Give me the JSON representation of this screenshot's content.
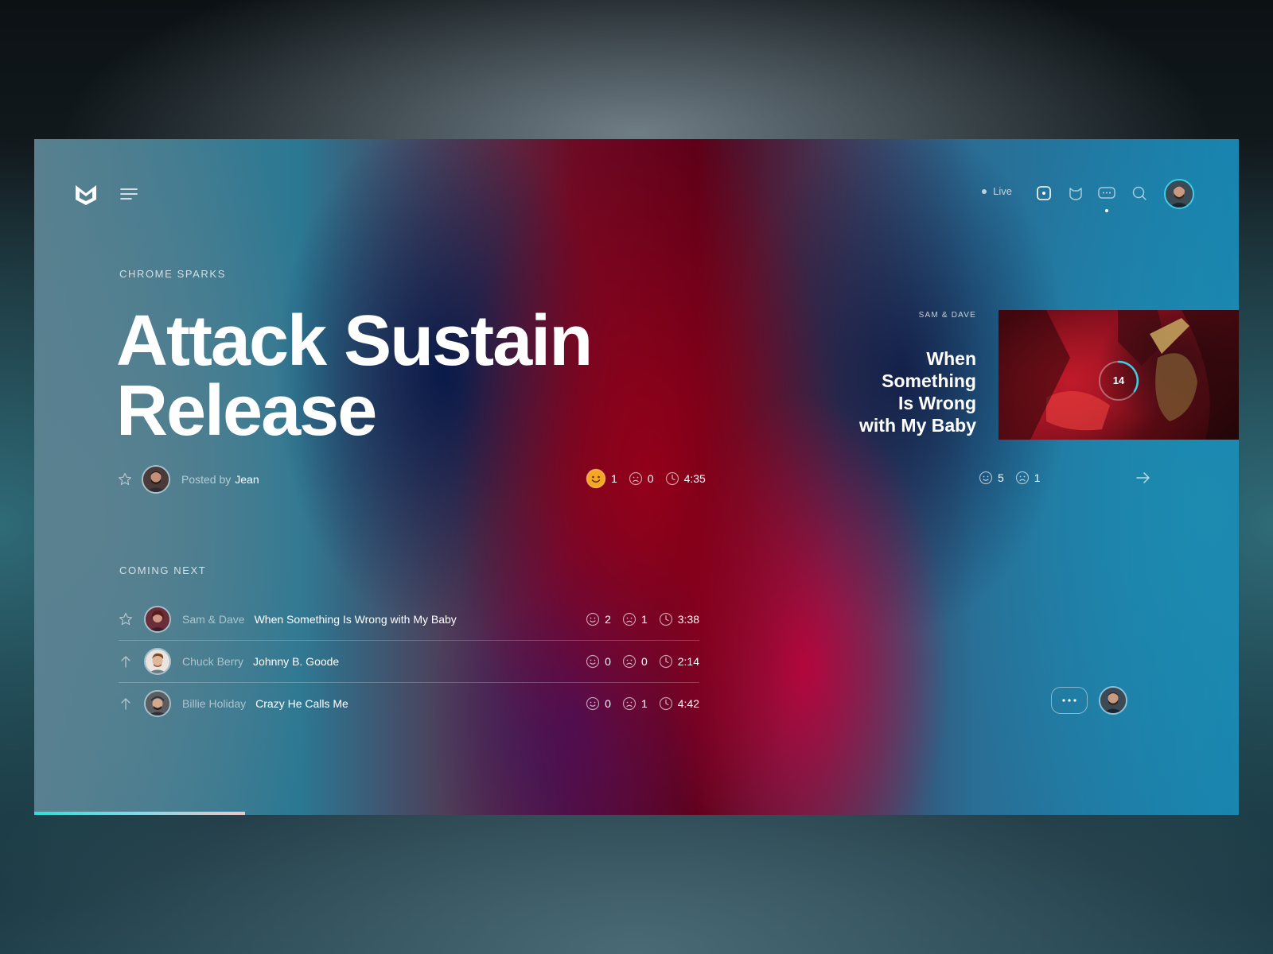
{
  "header": {
    "live_label": "Live",
    "icons": [
      "logo-icon",
      "menu-icon",
      "now-playing-icon",
      "cat-icon",
      "chat-icon",
      "search-icon"
    ]
  },
  "now_playing": {
    "artist": "CHROME SPARKS",
    "title_line1": "Attack Sustain",
    "title_line2": "Release",
    "posted_by_label": "Posted by",
    "posted_by_name": "Jean",
    "likes": "1",
    "dislikes": "0",
    "duration": "4:35"
  },
  "up_next_card": {
    "artist": "SAM & DAVE",
    "title_line1": "When",
    "title_line2": "Something",
    "title_line3": "Is Wrong",
    "title_line4": "with My Baby",
    "counter": "14",
    "likes": "5",
    "dislikes": "1"
  },
  "queue": {
    "heading": "COMING NEXT",
    "items": [
      {
        "artist": "Sam & Dave",
        "song": "When Something Is Wrong with My Baby",
        "likes": "2",
        "dislikes": "1",
        "duration": "3:38"
      },
      {
        "artist": "Chuck Berry",
        "song": "Johnny B. Goode",
        "likes": "0",
        "dislikes": "0",
        "duration": "2:14"
      },
      {
        "artist": "Billie Holiday",
        "song": "Crazy He Calls Me",
        "likes": "0",
        "dislikes": "1",
        "duration": "4:42"
      }
    ]
  },
  "playback": {
    "progress": 0.175
  },
  "colors": {
    "accent": "#3bd0e6",
    "like_active": "#f5a623"
  }
}
